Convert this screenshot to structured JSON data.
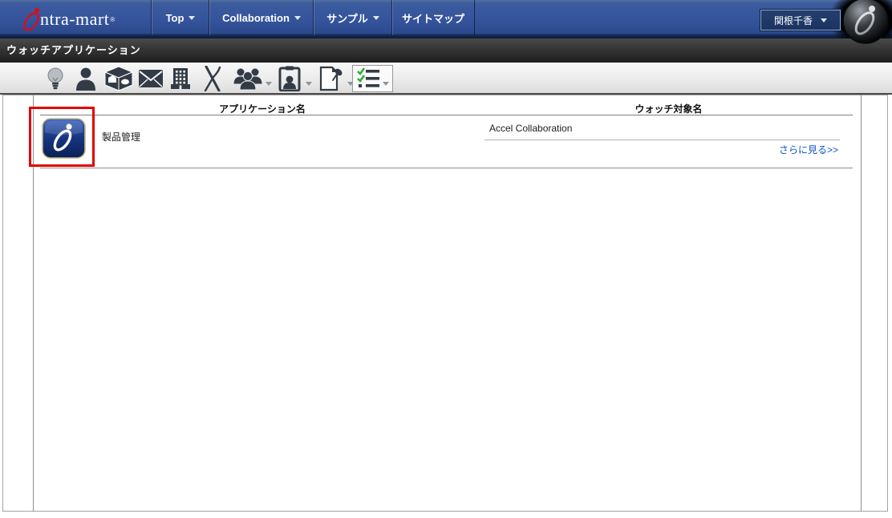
{
  "topnav": {
    "logo": {
      "text": "intra-mart",
      "text_display": "ntra-mart",
      "registered_mark": "®"
    },
    "items": [
      {
        "label": "Top",
        "has_dropdown": true
      },
      {
        "label": "Collaboration",
        "has_dropdown": true
      },
      {
        "label": "サンプル",
        "has_dropdown": true
      },
      {
        "label": "サイトマップ",
        "has_dropdown": false
      }
    ],
    "user": {
      "name": "関根千香"
    },
    "colors": {
      "bar_blue": "#34539b",
      "bar_edge": "#0d1c3c",
      "logo_red": "#cf1126"
    }
  },
  "titlebar": {
    "title": "ウォッチアプリケーション",
    "bg": "#2b2b2b"
  },
  "toolbar": {
    "icons": [
      {
        "name": "lightbulb-icon",
        "has_dropdown": false,
        "active": false
      },
      {
        "name": "user-icon",
        "has_dropdown": false,
        "active": false
      },
      {
        "name": "cube-icon",
        "has_dropdown": false,
        "active": false
      },
      {
        "name": "mail-icon",
        "has_dropdown": false,
        "active": false
      },
      {
        "name": "building-icon",
        "has_dropdown": false,
        "active": false
      },
      {
        "name": "crossed-tools-icon",
        "has_dropdown": false,
        "active": false
      },
      {
        "name": "users-group-icon",
        "has_dropdown": true,
        "active": false
      },
      {
        "name": "clipboard-user-icon",
        "has_dropdown": true,
        "active": false
      },
      {
        "name": "document-pin-icon",
        "has_dropdown": true,
        "active": false
      },
      {
        "name": "checklist-icon",
        "has_dropdown": true,
        "active": true
      }
    ],
    "icon_color": "#333c46",
    "check_green": "#2fae35"
  },
  "watch_table": {
    "columns": [
      "アプリケーション名",
      "ウォッチ対象名"
    ],
    "rows": [
      {
        "icon": "intra-mart-app-icon",
        "annotated_with_red_box": true,
        "application": "製品管理",
        "watch_targets": [
          "Accel Collaboration"
        ],
        "more_link": "さらに見る>>"
      }
    ],
    "link_color": "#0d52c8",
    "border_color": "#8f8f8f",
    "annotation_color": "#e30000"
  }
}
